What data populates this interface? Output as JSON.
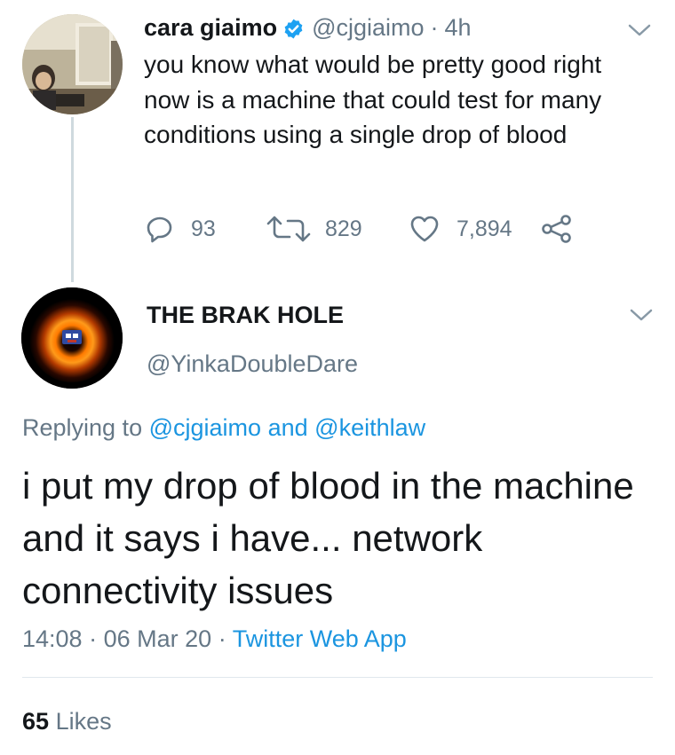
{
  "tweet": {
    "author_name": "cara giaimo",
    "verified": true,
    "handle": "@cjgiaimo",
    "separator": "·",
    "time_ago": "4h",
    "text": "you know what would be pretty good right now is a machine that could test for many conditions using a single drop of blood",
    "replies": "93",
    "retweets": "829",
    "likes": "7,894",
    "icons": [
      "reply-icon",
      "retweet-icon",
      "like-icon",
      "share-icon",
      "caret-down-icon",
      "verified-badge-icon"
    ]
  },
  "reply": {
    "author_name": "THE BRAK HOLE",
    "handle": "@YinkaDoubleDare",
    "replying_prefix": "Replying to",
    "replying_to_1": "@cjgiaimo",
    "replying_and": "and",
    "replying_to_2": "@keithlaw",
    "text": "i put my drop of blood in the machine and it says i have... network connectivity issues",
    "time": "14:08",
    "date": "06 Mar 20",
    "separator": "·",
    "source": "Twitter Web App",
    "likes_count": "65",
    "likes_label": "Likes"
  },
  "colors": {
    "text": "#14171a",
    "muted": "#657786",
    "link": "#1b95e0",
    "verified": "#1da1f2",
    "divider": "#e1e8ed"
  }
}
